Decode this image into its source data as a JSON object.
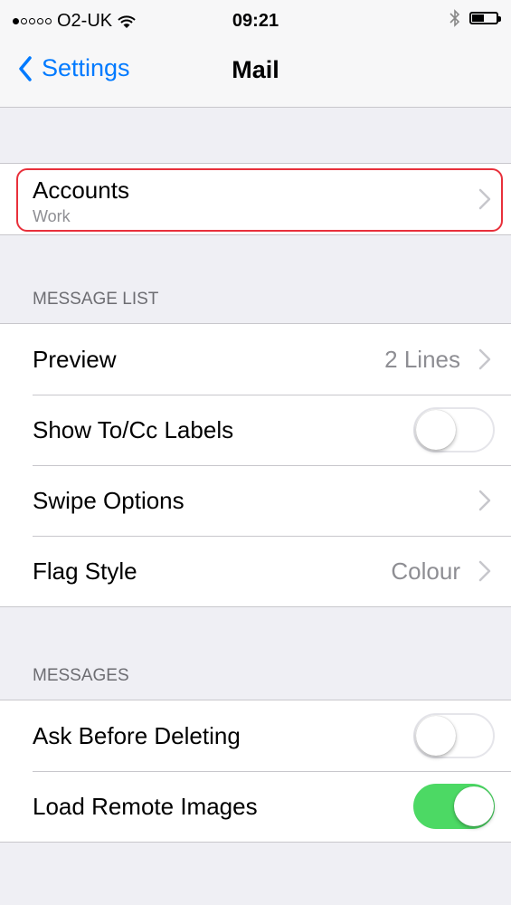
{
  "status_bar": {
    "carrier": "O2-UK",
    "time": "09:21",
    "wifi_icon": "wifi-icon",
    "bluetooth_icon": "bluetooth-icon",
    "battery_icon": "battery-icon",
    "signal_strength": 1
  },
  "nav": {
    "back_label": "Settings",
    "title": "Mail"
  },
  "accounts": {
    "title": "Accounts",
    "subtitle": "Work"
  },
  "message_list": {
    "header": "MESSAGE LIST",
    "preview_label": "Preview",
    "preview_value": "2 Lines",
    "show_to_cc_label": "Show To/Cc Labels",
    "show_to_cc_on": false,
    "swipe_options_label": "Swipe Options",
    "flag_style_label": "Flag Style",
    "flag_style_value": "Colour"
  },
  "messages": {
    "header": "MESSAGES",
    "ask_before_deleting_label": "Ask Before Deleting",
    "ask_before_deleting_on": false,
    "load_remote_images_label": "Load Remote Images",
    "load_remote_images_on": true
  },
  "colors": {
    "accent": "#007aff",
    "toggle_on": "#4cd964",
    "highlight": "#e8303b",
    "background": "#efeff4"
  }
}
